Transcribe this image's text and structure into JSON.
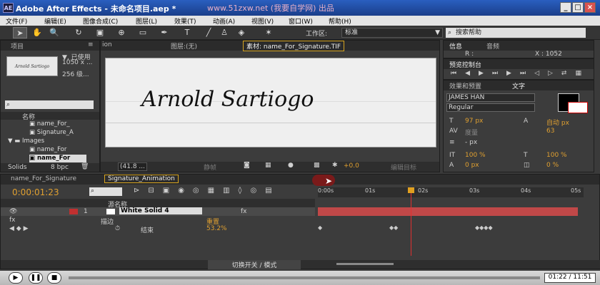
{
  "window": {
    "title": "Adobe After Effects - 未命名项目.aep *",
    "watermark": "www.51zxw.net (我要自学网) 出品",
    "logo": "AE",
    "min": "_",
    "max": "□",
    "close": "×"
  },
  "menu": [
    "文件(F)",
    "编辑(E)",
    "图像合成(C)",
    "图层(L)",
    "效果(T)",
    "动画(A)",
    "视图(V)",
    "窗口(W)",
    "帮助(H)"
  ],
  "toolbar": {
    "workspace_label": "工作区:",
    "workspace_value": "标准",
    "search_placeholder": "搜索帮助"
  },
  "project": {
    "tab": "项目",
    "tab_partial": "ion",
    "used_text": "▼, 已使用",
    "size_text": "1050 x ...",
    "depth_text": "256 级...",
    "thumb_text": "Arnold Sartiogo",
    "col_name": "名称",
    "items": [
      "name_For_",
      "Signature_A",
      "Images",
      "name_For",
      "name_For"
    ],
    "partial_last": "Solids",
    "bpc": "8 bpc"
  },
  "layer_tab": "图层:(无)",
  "footage": {
    "tab": "素材: name_For_Signature.TIF",
    "signature": "Arnold Sartiogo",
    "zoom": "(41.8 ...",
    "value": "+0.0",
    "edit_btn": "编辑目标",
    "still": "静帧"
  },
  "info": {
    "tab1": "信息",
    "tab2": "音频",
    "r_label": "R :",
    "x_text": "X : 1052"
  },
  "preview": {
    "tab": "预览控制台"
  },
  "effects": {
    "tab": "效果和预置",
    "character_tab": "文字",
    "font": "JAMES HAN",
    "style": "Regular",
    "size": "97 px",
    "leading": "自动 px",
    "tracking_label": "度量",
    "tracking_value": "63",
    "stroke": "- px",
    "scale_v": "100 %",
    "scale_h": "100 %",
    "baseline": "0 px",
    "tsume": "0 %"
  },
  "timeline": {
    "tab1": "name_For_Signature",
    "tab2": "Signature_Animation",
    "timecode": "0:00:01:23",
    "col_name": "源名称",
    "layer_num": "1",
    "layer_name": "White Solid 4",
    "fx_label": "fx",
    "sub1": "描边",
    "sub1_val": "重置",
    "sub2": "结束",
    "sub2_val": "53.2%",
    "ruler": [
      "0:00s",
      "01s",
      "02s",
      "03s",
      "04s",
      "05s"
    ],
    "switch_label": "切换开关 / 模式"
  },
  "taskbar": {
    "time": "01:22 / 11:51"
  }
}
